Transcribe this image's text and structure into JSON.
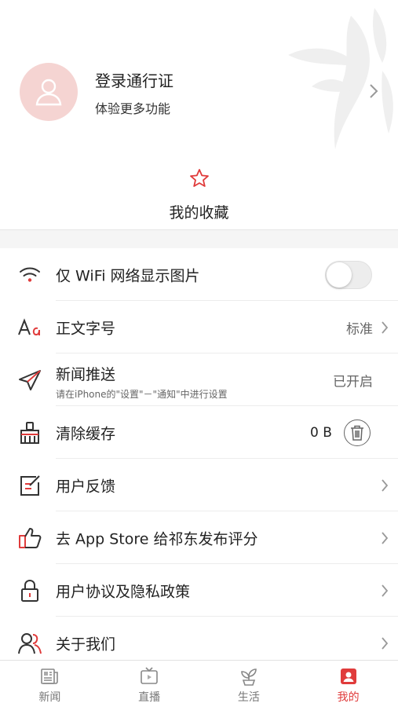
{
  "profile": {
    "title": "登录通行证",
    "subtitle": "体验更多功能"
  },
  "favorites": {
    "label": "我的收藏",
    "icon": "star-icon"
  },
  "settings": {
    "wifi_images": {
      "label": "仅 WiFi 网络显示图片",
      "enabled": false,
      "icon": "wifi-icon"
    },
    "font_size": {
      "label": "正文字号",
      "value": "标准",
      "icon": "font-size-icon"
    },
    "push": {
      "label": "新闻推送",
      "hint": "请在iPhone的\"设置\"－\"通知\"中进行设置",
      "value": "已开启",
      "icon": "send-icon"
    },
    "cache": {
      "label": "清除缓存",
      "value": "0 B",
      "icon": "broom-icon"
    },
    "feedback": {
      "label": "用户反馈",
      "icon": "feedback-icon"
    },
    "rate": {
      "label": "去 App Store 给祁东发布评分",
      "icon": "thumbs-up-icon"
    },
    "privacy": {
      "label": "用户协议及隐私政策",
      "icon": "lock-icon"
    },
    "about": {
      "label": "关于我们",
      "icon": "users-icon"
    }
  },
  "tabbar": {
    "items": [
      {
        "label": "新闻",
        "icon": "news-icon",
        "active": false
      },
      {
        "label": "直播",
        "icon": "live-tv-icon",
        "active": false
      },
      {
        "label": "生活",
        "icon": "sprout-icon",
        "active": false
      },
      {
        "label": "我的",
        "icon": "profile-icon",
        "active": true
      }
    ]
  },
  "colors": {
    "accent": "#e03b3b",
    "avatar_bg": "#f5d4d2",
    "text": "#222222",
    "muted": "#666666",
    "page_bg": "#f5f5f5"
  }
}
